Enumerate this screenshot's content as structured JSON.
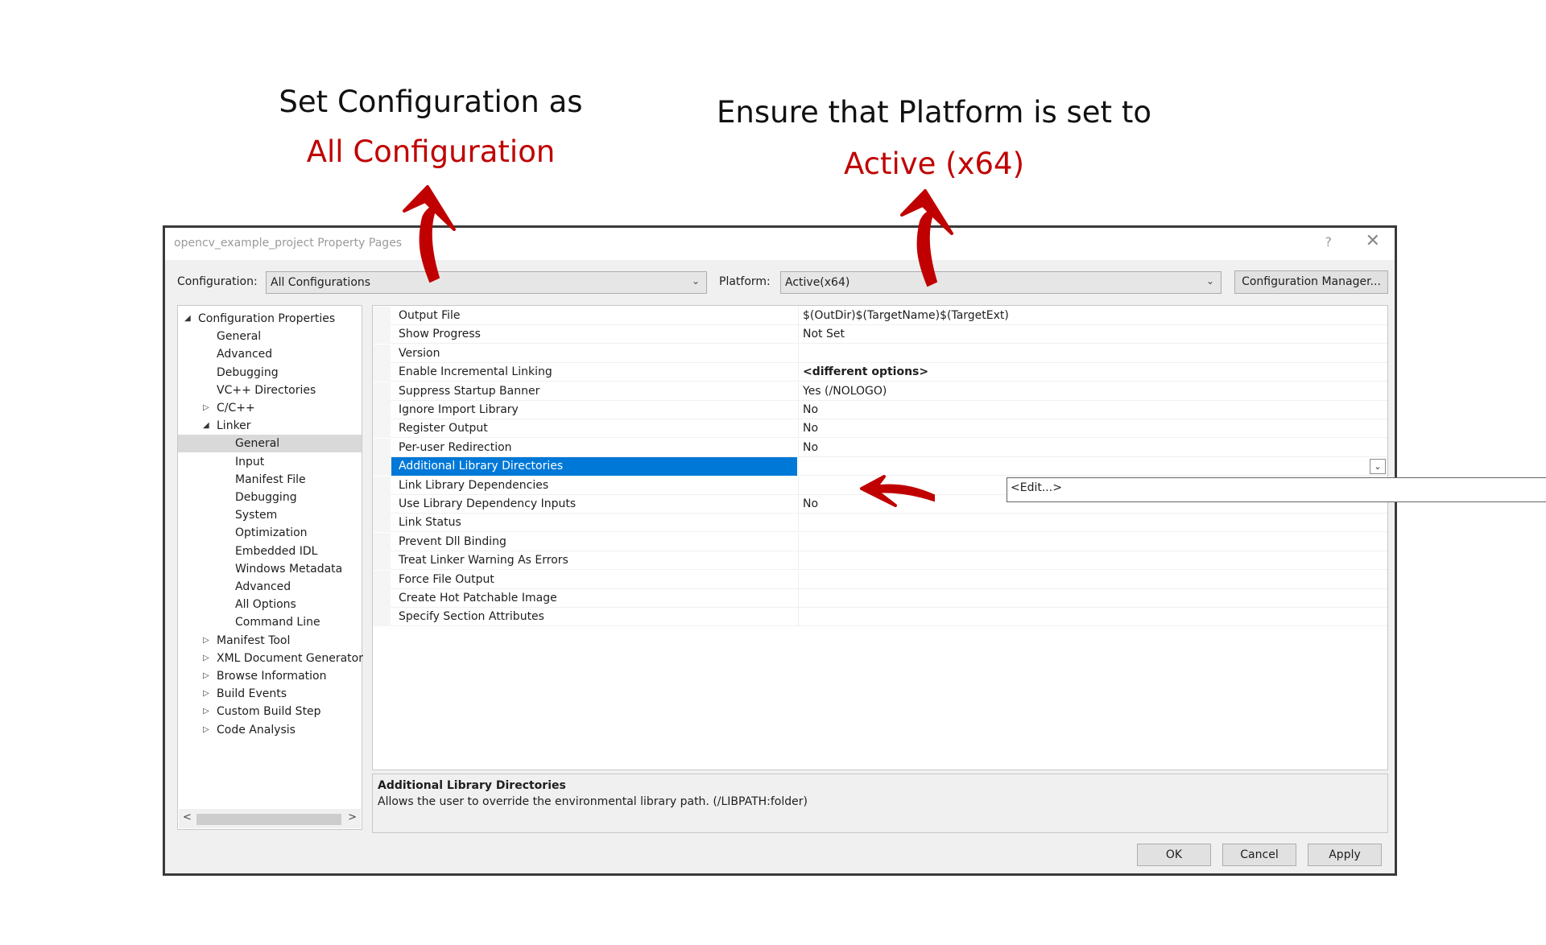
{
  "annotations": {
    "left_line1": "Set Configuration as",
    "left_line2": "All Configuration",
    "right_line1": "Ensure that Platform is set to",
    "right_line2": "Active (x64)"
  },
  "colors": {
    "annotation_red": "#c00000",
    "selection_blue": "#0078d7"
  },
  "window": {
    "title": "opencv_example_project Property Pages",
    "help_icon": "?",
    "close_icon": "✕"
  },
  "config_bar": {
    "configuration_label": "Configuration:",
    "configuration_value": "All Configurations",
    "platform_label": "Platform:",
    "platform_value": "Active(x64)",
    "manager_button": "Configuration Manager..."
  },
  "tree": {
    "items": [
      {
        "label": "Configuration Properties",
        "level": 0,
        "arrow": "◢"
      },
      {
        "label": "General",
        "level": 1,
        "arrow": ""
      },
      {
        "label": "Advanced",
        "level": 1,
        "arrow": ""
      },
      {
        "label": "Debugging",
        "level": 1,
        "arrow": ""
      },
      {
        "label": "VC++ Directories",
        "level": 1,
        "arrow": ""
      },
      {
        "label": "C/C++",
        "level": 1,
        "arrow": "▷"
      },
      {
        "label": "Linker",
        "level": 1,
        "arrow": "◢"
      },
      {
        "label": "General",
        "level": 2,
        "arrow": "",
        "selected": true
      },
      {
        "label": "Input",
        "level": 2,
        "arrow": ""
      },
      {
        "label": "Manifest File",
        "level": 2,
        "arrow": ""
      },
      {
        "label": "Debugging",
        "level": 2,
        "arrow": ""
      },
      {
        "label": "System",
        "level": 2,
        "arrow": ""
      },
      {
        "label": "Optimization",
        "level": 2,
        "arrow": ""
      },
      {
        "label": "Embedded IDL",
        "level": 2,
        "arrow": ""
      },
      {
        "label": "Windows Metadata",
        "level": 2,
        "arrow": ""
      },
      {
        "label": "Advanced",
        "level": 2,
        "arrow": ""
      },
      {
        "label": "All Options",
        "level": 2,
        "arrow": ""
      },
      {
        "label": "Command Line",
        "level": 2,
        "arrow": ""
      },
      {
        "label": "Manifest Tool",
        "level": 1,
        "arrow": "▷"
      },
      {
        "label": "XML Document Generator",
        "level": 1,
        "arrow": "▷"
      },
      {
        "label": "Browse Information",
        "level": 1,
        "arrow": "▷"
      },
      {
        "label": "Build Events",
        "level": 1,
        "arrow": "▷"
      },
      {
        "label": "Custom Build Step",
        "level": 1,
        "arrow": "▷"
      },
      {
        "label": "Code Analysis",
        "level": 1,
        "arrow": "▷"
      }
    ],
    "scroll_left": "<",
    "scroll_right": ">"
  },
  "properties": [
    {
      "name": "Output File",
      "value": "$(OutDir)$(TargetName)$(TargetExt)"
    },
    {
      "name": "Show Progress",
      "value": "Not Set"
    },
    {
      "name": "Version",
      "value": ""
    },
    {
      "name": "Enable Incremental Linking",
      "value": "<different options>",
      "bold": true
    },
    {
      "name": "Suppress Startup Banner",
      "value": "Yes (/NOLOGO)"
    },
    {
      "name": "Ignore Import Library",
      "value": "No"
    },
    {
      "name": "Register Output",
      "value": "No"
    },
    {
      "name": "Per-user Redirection",
      "value": "No"
    },
    {
      "name": "Additional Library Directories",
      "value": "",
      "selected": true
    },
    {
      "name": "Link Library Dependencies",
      "value": ""
    },
    {
      "name": "Use Library Dependency Inputs",
      "value": "No"
    },
    {
      "name": "Link Status",
      "value": ""
    },
    {
      "name": "Prevent Dll Binding",
      "value": ""
    },
    {
      "name": "Treat Linker Warning As Errors",
      "value": ""
    },
    {
      "name": "Force File Output",
      "value": ""
    },
    {
      "name": "Create Hot Patchable Image",
      "value": ""
    },
    {
      "name": "Specify Section Attributes",
      "value": ""
    }
  ],
  "dropdown": {
    "option": "<Edit...>"
  },
  "description": {
    "title": "Additional Library Directories",
    "text": "Allows the user to override the environmental library path. (/LIBPATH:folder)"
  },
  "buttons": {
    "ok": "OK",
    "cancel": "Cancel",
    "apply": "Apply"
  }
}
